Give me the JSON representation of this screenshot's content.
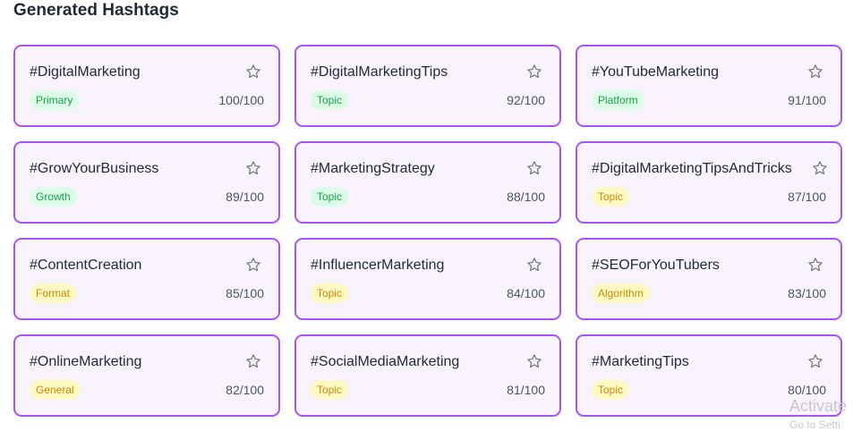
{
  "header": {
    "title": "Generated Hashtags"
  },
  "colors": {
    "card_border": "#a855f7",
    "card_bg": "#f8f3fd",
    "badge_green": "#dcfce7",
    "badge_yellow": "#fef9c3"
  },
  "cards": [
    {
      "tag": "#DigitalMarketing",
      "category": "Primary",
      "category_style": "green",
      "score": "100/100"
    },
    {
      "tag": "#DigitalMarketingTips",
      "category": "Topic",
      "category_style": "green",
      "score": "92/100"
    },
    {
      "tag": "#YouTubeMarketing",
      "category": "Platform",
      "category_style": "green",
      "score": "91/100"
    },
    {
      "tag": "#GrowYourBusiness",
      "category": "Growth",
      "category_style": "green",
      "score": "89/100"
    },
    {
      "tag": "#MarketingStrategy",
      "category": "Topic",
      "category_style": "green",
      "score": "88/100"
    },
    {
      "tag": "#DigitalMarketingTipsAndTricks",
      "category": "Topic",
      "category_style": "yellow",
      "score": "87/100"
    },
    {
      "tag": "#ContentCreation",
      "category": "Format",
      "category_style": "yellow",
      "score": "85/100"
    },
    {
      "tag": "#InfluencerMarketing",
      "category": "Topic",
      "category_style": "yellow",
      "score": "84/100"
    },
    {
      "tag": "#SEOForYouTubers",
      "category": "Algorithm",
      "category_style": "yellow",
      "score": "83/100"
    },
    {
      "tag": "#OnlineMarketing",
      "category": "General",
      "category_style": "yellow",
      "score": "82/100"
    },
    {
      "tag": "#SocialMediaMarketing",
      "category": "Topic",
      "category_style": "yellow",
      "score": "81/100"
    },
    {
      "tag": "#MarketingTips",
      "category": "Topic",
      "category_style": "yellow",
      "score": "80/100"
    }
  ],
  "star_icon": "star-outline-icon",
  "watermark": {
    "line1": "Activate",
    "line2": "Go to Setti"
  }
}
